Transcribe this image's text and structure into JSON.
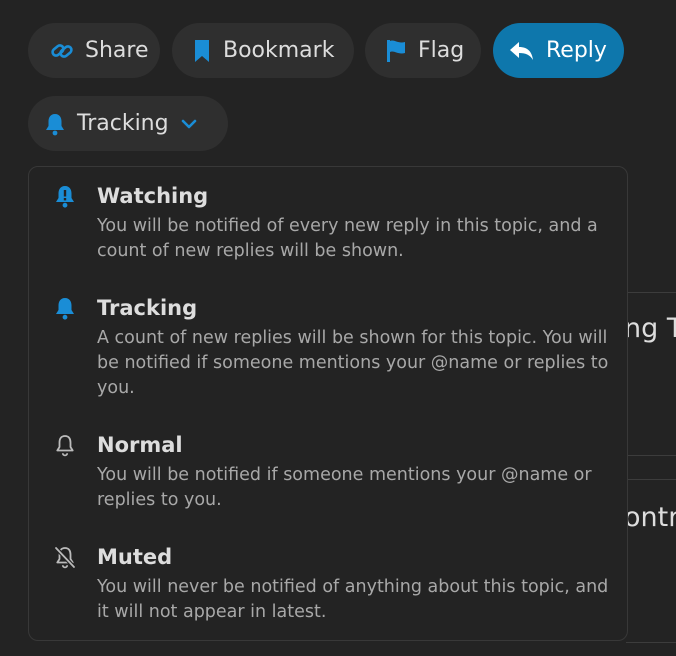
{
  "toolbar": {
    "share": "Share",
    "bookmark": "Bookmark",
    "flag": "Flag",
    "reply": "Reply"
  },
  "notification_button": {
    "label": "Tracking"
  },
  "background": {
    "fragment_1": "ng T",
    "fragment_2": "ontr"
  },
  "menu": {
    "options": [
      {
        "title": "Watching",
        "description": "You will be notified of every new reply in this topic, and a count of new replies will be shown.",
        "icon": "bell-exclamation-icon"
      },
      {
        "title": "Tracking",
        "description": "A count of new replies will be shown for this topic. You will be notified if someone mentions your @name or replies to you.",
        "icon": "bell-filled-icon"
      },
      {
        "title": "Normal",
        "description": "You will be notified if someone mentions your @name or replies to you.",
        "icon": "bell-outline-icon"
      },
      {
        "title": "Muted",
        "description": "You will never be notified of anything about this topic, and it will not appear in latest.",
        "icon": "bell-slash-icon"
      }
    ]
  },
  "colors": {
    "accent": "#0e77ac",
    "icon_blue": "#1a8dd6",
    "background": "#232323",
    "button_bg": "#2f2f2f"
  }
}
